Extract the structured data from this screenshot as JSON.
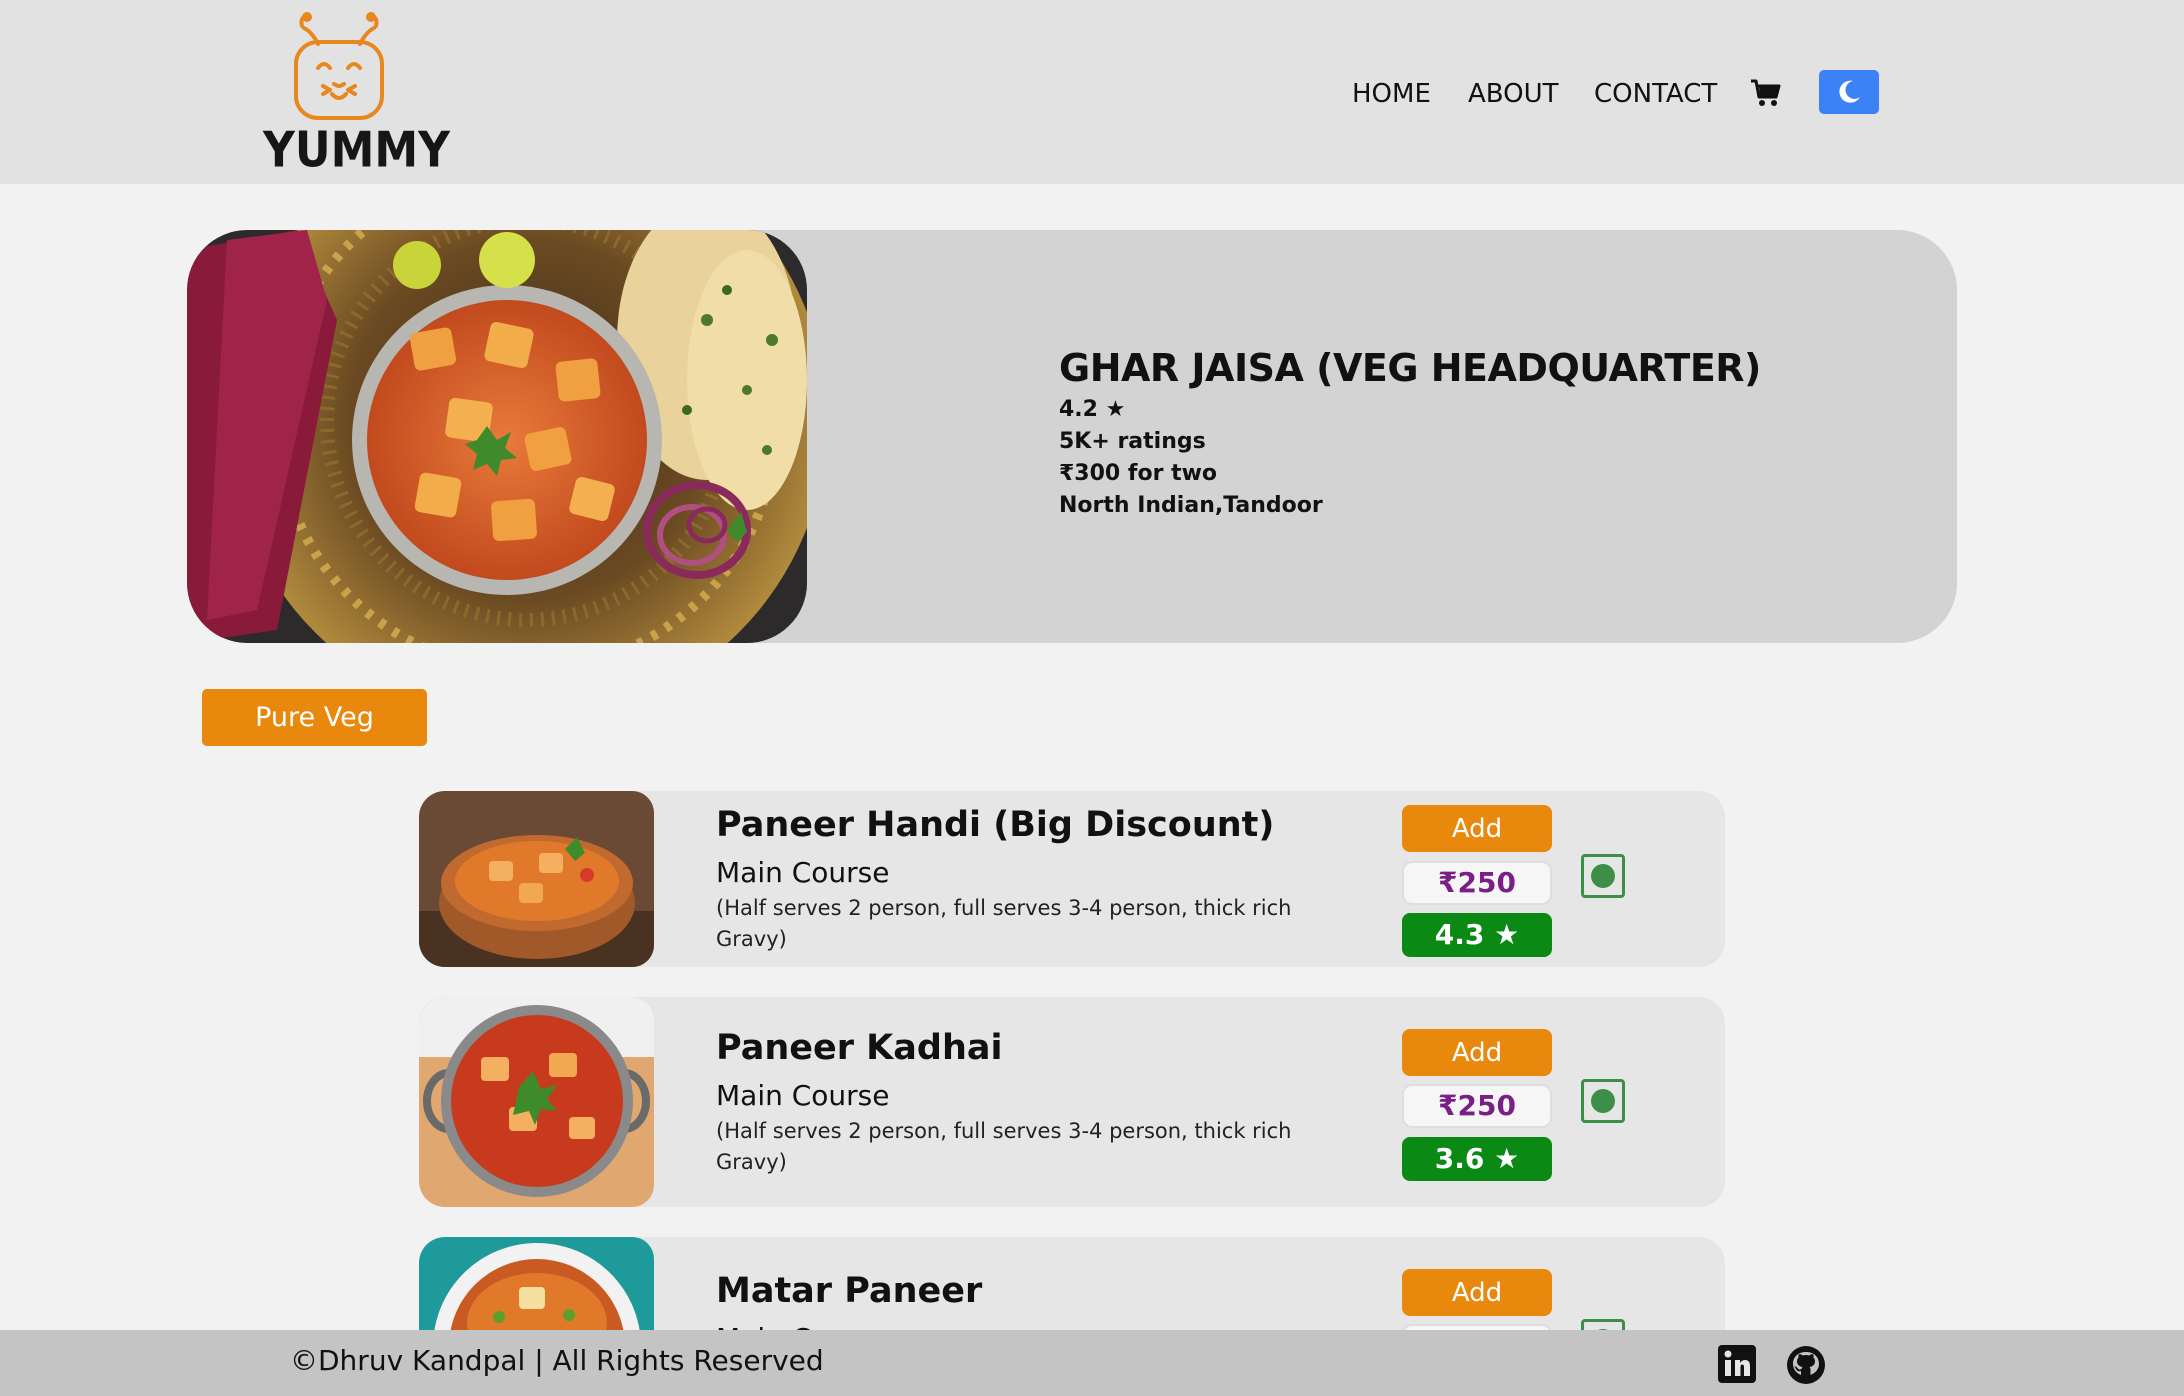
{
  "header": {
    "logo_text": "YUMMY",
    "logo_icon": "smiley-bug-icon",
    "nav": [
      "HOME",
      "ABOUT",
      "CONTACT"
    ],
    "cart_icon": "cart-icon",
    "theme_toggle_icon": "moon-icon"
  },
  "restaurant": {
    "name": "GHAR JAISA (VEG HEADQUARTER)",
    "rating": "4.2 ★",
    "ratings_count": "5K+ ratings",
    "cost": "₹300 for two",
    "cuisines": "North Indian,Tandoor"
  },
  "filter": {
    "pure_veg_label": "Pure Veg"
  },
  "menu": [
    {
      "name": "Paneer Handi (Big Discount)",
      "category": "Main Course",
      "description": "(Half serves 2 person, full serves 3-4 person, thick rich Gravy)",
      "add_label": "Add",
      "price": "₹250",
      "rating": "4.3 ★"
    },
    {
      "name": "Paneer Kadhai",
      "category": "Main Course",
      "description": "(Half serves 2 person, full serves 3-4 person, thick rich Gravy)",
      "add_label": "Add",
      "price": "₹250",
      "rating": "3.6 ★"
    },
    {
      "name": "Matar Paneer",
      "category": "Main Course",
      "add_label": "Add"
    }
  ],
  "footer": {
    "copyright": "©Dhruv Kandpal | All Rights Reserved",
    "icons": [
      "linkedin-icon",
      "github-icon"
    ]
  },
  "colors": {
    "accent_orange": "#e8880c",
    "toggle_blue": "#3b82f6",
    "rating_green": "#0a8a14",
    "price_purple": "#7a1f86",
    "veg_green": "#3d8f47"
  }
}
